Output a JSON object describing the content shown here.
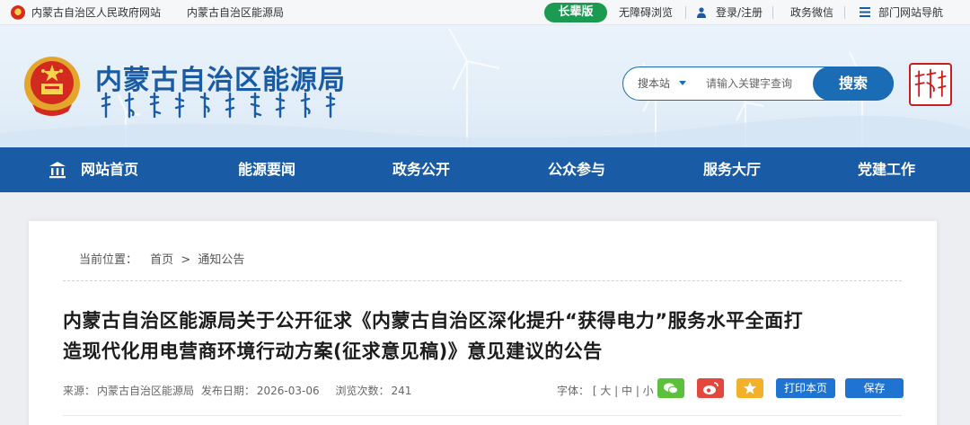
{
  "topbar": {
    "gov_site": "内蒙古自治区人民政府网站",
    "energy_site": "内蒙古自治区能源局",
    "elder_mode": "长辈版",
    "accessibility": "无障碍浏览",
    "login": "登录/注册",
    "wechat": "政务微信",
    "dept_nav": "部门网站导航"
  },
  "header": {
    "title": "内蒙古自治区能源局"
  },
  "search": {
    "scope": "搜本站",
    "placeholder": "请输入关键字查询",
    "button": "搜索"
  },
  "nav": {
    "items": [
      "网站首页",
      "能源要闻",
      "政务公开",
      "公众参与",
      "服务大厅",
      "党建工作"
    ]
  },
  "breadcrumb": {
    "prefix": "当前位置：",
    "home": "首页",
    "separator": ">",
    "current": "通知公告"
  },
  "article": {
    "title_line1": "内蒙古自治区能源局关于公开征求《内蒙古自治区深化提升“获得电力”服务水平全面打",
    "title_line2": "造现代化用电营商环境行动方案(征求意见稿)》意见建议的公告",
    "source_label": "来源：",
    "source": "内蒙古自治区能源局",
    "date_label": "发布日期：",
    "date": "2026-03-06",
    "views_label": "浏览次数：",
    "views": "241",
    "font_label": "字体：",
    "font_sizes": "[ 大 | 中 | 小 ]",
    "print": "打印本页",
    "save": "保存"
  },
  "colors": {
    "brand_blue": "#1a5ba6",
    "elder_green": "#1b9a52",
    "wechat_green": "#5bc13c",
    "weibo_red": "#e2483d",
    "qzone_yellow": "#f3b12a"
  }
}
